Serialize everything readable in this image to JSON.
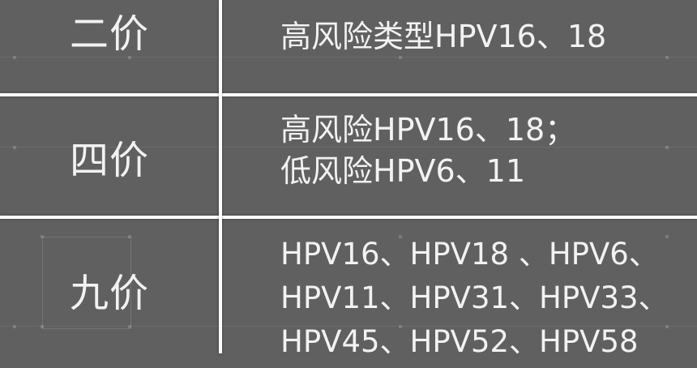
{
  "rows": [
    {
      "label": "二价",
      "lines": [
        "高风险类型HPV16、18"
      ]
    },
    {
      "label": "四价",
      "lines": [
        "高风险HPV16、18；",
        "低风险HPV6、11"
      ]
    },
    {
      "label": "九价",
      "lines": [
        "HPV16、HPV18 、HPV6、",
        "HPV11、HPV31、HPV33、",
        "HPV45、HPV52、HPV58"
      ]
    }
  ]
}
